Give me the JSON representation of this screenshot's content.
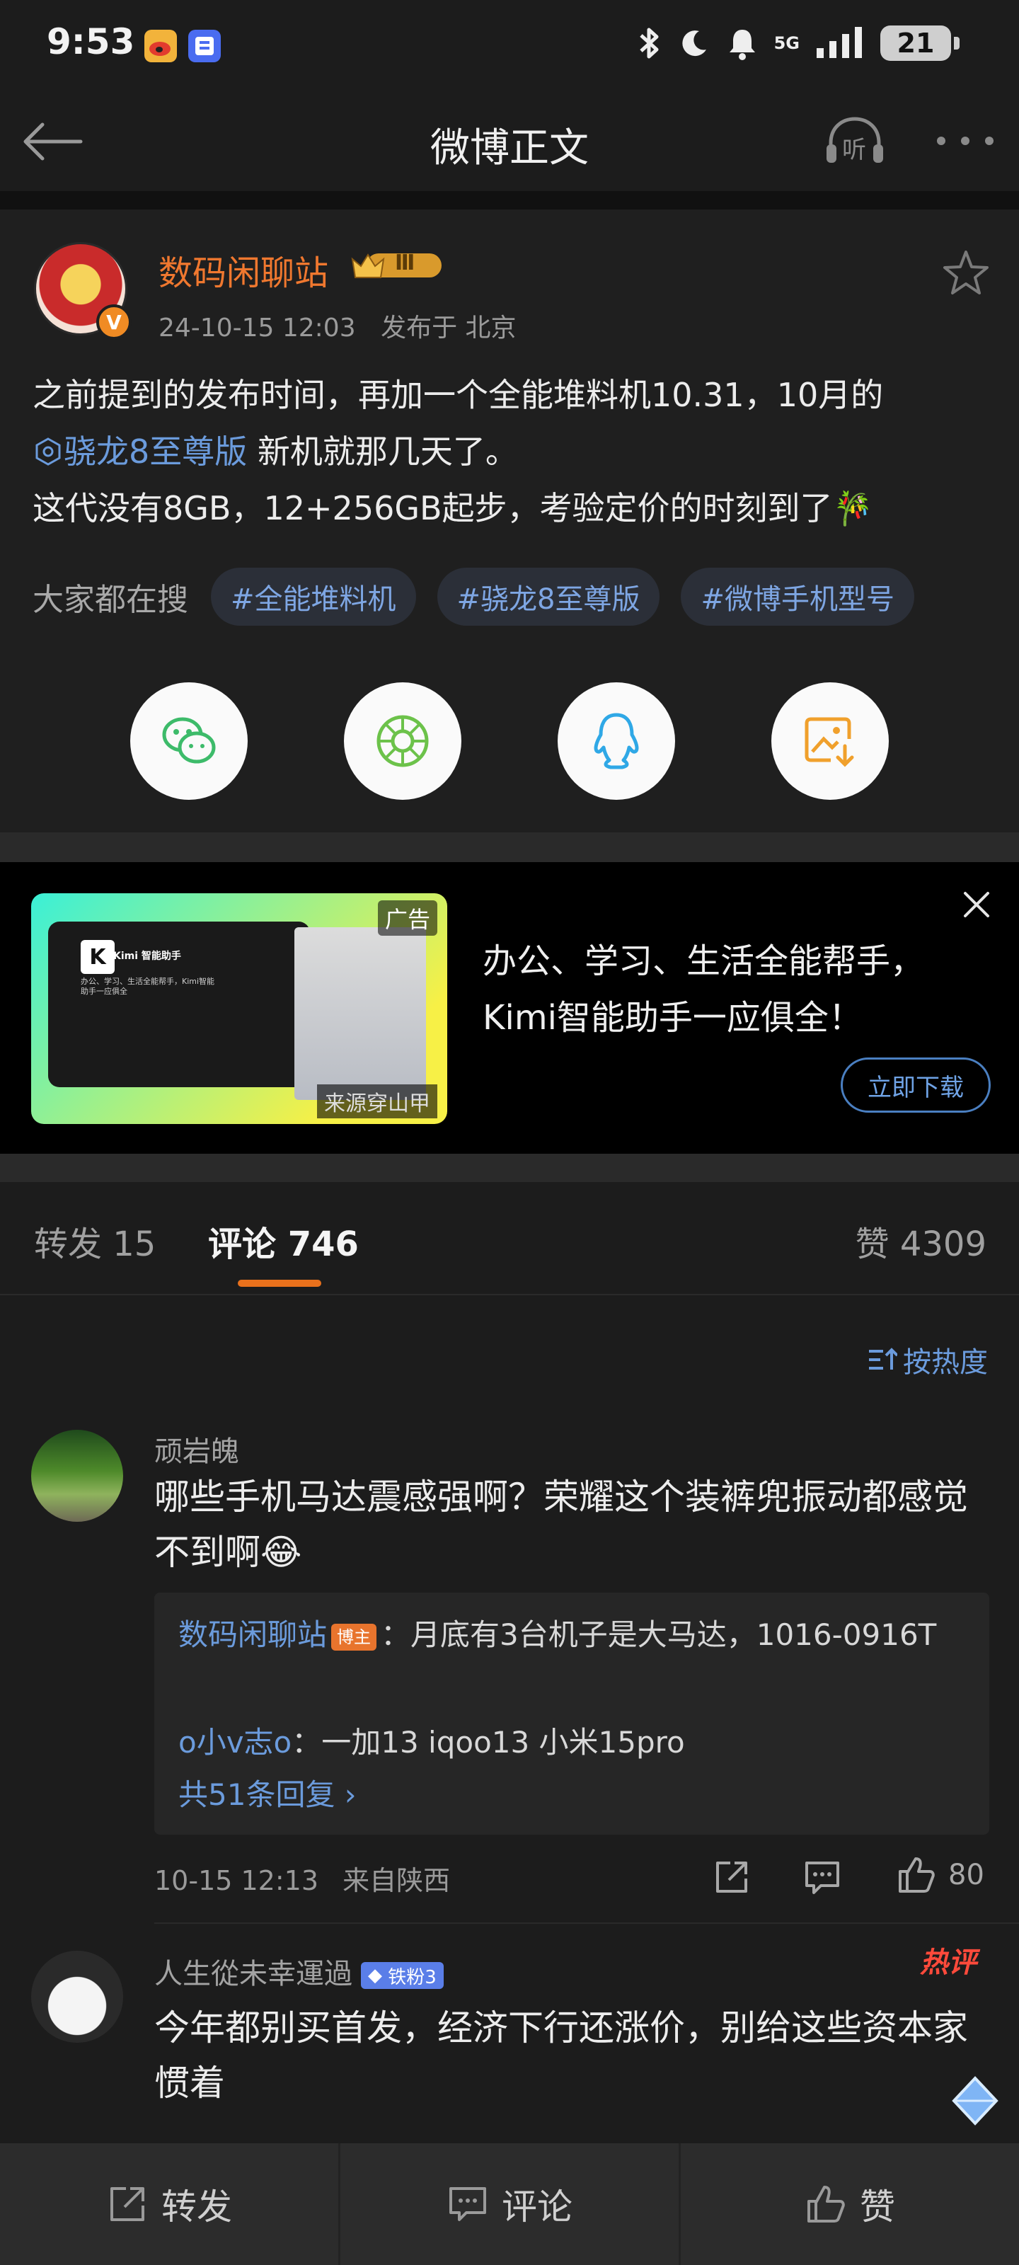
{
  "status_bar": {
    "time": "9:53",
    "network": "5G",
    "battery": "21"
  },
  "nav": {
    "title": "微博正文",
    "listen_label": "听"
  },
  "post": {
    "author": "数码闲聊站",
    "level_badge": "Ⅲ",
    "verify_mark": "V",
    "date": "24-10-15 12:03",
    "location": "发布于 北京",
    "text_part1": "之前提到的发布时间，再加一个全能堆料机10.31，10月的",
    "topic": "骁龙8至尊版",
    "text_part2": " 新机就那几天了。",
    "text_line3": "这代没有8GB，12+256GB起步，考验定价的时刻到了🎋",
    "search_label": "大家都在搜",
    "tags": [
      "#全能堆料机",
      "#骁龙8至尊版",
      "#微博手机型号"
    ]
  },
  "share": {
    "icons": [
      "wechat-icon",
      "moments-icon",
      "qq-icon",
      "save-image-icon"
    ]
  },
  "ad": {
    "badge": "广告",
    "source": "来源穿山甲",
    "thumb_title": "Kimi 智能助手",
    "thumb_subtitle": "办公、学习、生活全能帮手，Kimi智能助手一应俱全",
    "line1": "办公、学习、生活全能帮手，",
    "line2": "Kimi智能助手一应俱全！",
    "cta": "立即下载"
  },
  "tabs": {
    "repost": "转发 15",
    "comments": "评论 746",
    "likes": "赞 4309"
  },
  "sort": {
    "label": "按热度"
  },
  "comment1": {
    "name": "顽岩魄",
    "text": "哪些手机马达震感强啊？荣耀这个装裤兜振动都感觉不到啊😂",
    "reply1_user": "数码闲聊站",
    "reply1_tag": "博主",
    "reply1_text": "：月底有3台机子是大马达，1016-0916T",
    "reply2_user": "o小v志o",
    "reply2_text": "：一加13 iqoo13 小米15pro",
    "more_replies": "共51条回复 ›",
    "time": "10-15 12:13",
    "from": "来自陕西",
    "likes": "80"
  },
  "comment2": {
    "name": "人生從未幸運過",
    "fan_badge": "铁粉3",
    "hot_label": "热评",
    "text": "今年都别买首发，经济下行还涨价，别给这些资本家惯着"
  },
  "bottom": {
    "repost": "转发",
    "comment": "评论",
    "like": "赞"
  }
}
